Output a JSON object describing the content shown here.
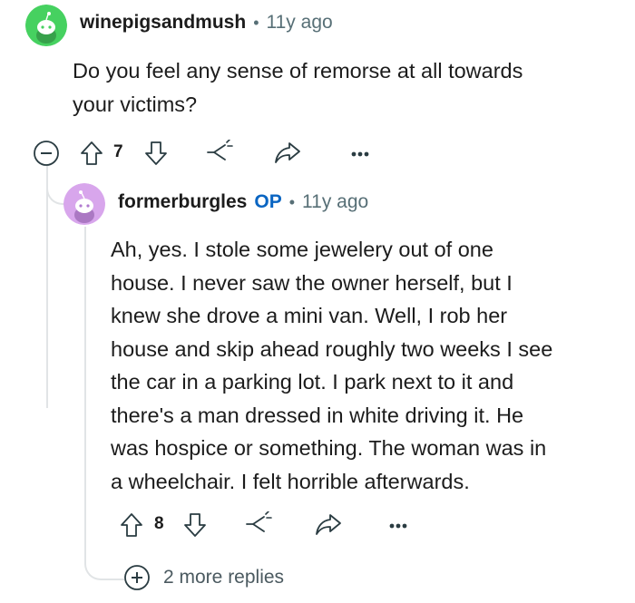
{
  "comments": [
    {
      "username": "winepigsandmush",
      "time": "11y ago",
      "body_lines": [
        "Do you feel any sense of remorse at all towards",
        "your victims?"
      ],
      "votes": "7",
      "avatar_color": "#46d160"
    },
    {
      "username": "formerburgles",
      "op_badge": "OP",
      "time": "11y ago",
      "body_lines": [
        "Ah, yes. I stole some jewelery out of one",
        "house. I never saw the owner herself, but I",
        "knew she drove a mini van. Well, I rob her",
        "house and skip ahead roughly two weeks I see",
        "the car in a parking lot. I park next to it and",
        "there's a man dressed in white driving it. He",
        "was hospice or something. The woman was in",
        "a wheelchair. I felt horrible afterwards."
      ],
      "votes": "8",
      "avatar_color": "#d8a6ec"
    }
  ],
  "separator": "•",
  "more_replies": "2 more replies",
  "colors": {
    "accent_op": "#0a65c2",
    "meta_gray": "#576f76",
    "icon_gray": "#2a3c42",
    "thread_line": "#e1e4e6"
  },
  "icons": [
    "collapse-icon",
    "upvote-icon",
    "downvote-icon",
    "award-icon",
    "share-icon",
    "more-options-icon",
    "expand-replies-icon"
  ]
}
